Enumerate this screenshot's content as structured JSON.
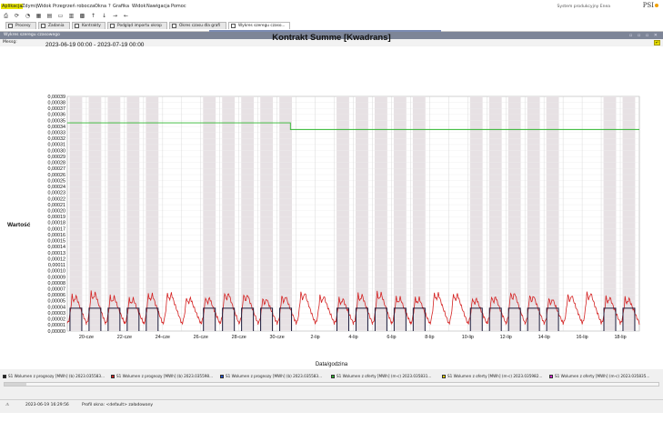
{
  "menu": {
    "items": [
      "Aplikacja",
      "Zdymij",
      "Widok",
      "Przegrzeń robocza",
      "Okna",
      "?",
      "Grafika",
      "Widok",
      "Nawigacja",
      "Pomoc"
    ],
    "highlight_color": "#e8e600"
  },
  "header": {
    "system_name": "System produkcyjny Enea",
    "logo_text": "PSI"
  },
  "toolbar": {
    "icons": [
      "print-icon",
      "refresh-icon",
      "chart-icon",
      "grid-icon",
      "table-icon",
      "window-icon",
      "layout-icon",
      "tile-icon",
      "arrow-up-icon",
      "arrow-down-icon",
      "arrow-right-icon",
      "arrow-left-icon"
    ]
  },
  "tabs": [
    {
      "label": "Procesy",
      "active": false
    },
    {
      "label": "Zadania",
      "active": false
    },
    {
      "label": "Kontrakty",
      "active": false
    },
    {
      "label": "Podgląd importu okrop",
      "active": false
    },
    {
      "label": "Okres czasu dla grafi",
      "active": false
    },
    {
      "label": "Wykres szeregu czaso...",
      "active": true
    }
  ],
  "panel": {
    "title": "Wykres szeregu czasowego",
    "controls": "▫ ▫ ▫ ✕"
  },
  "message_bar": {
    "label": "Messg:"
  },
  "chart_data": {
    "type": "line",
    "title": "Kontrakt Summe [Kwadrans]",
    "date_range": "2023-06-19 00:00 - 2023-07-19 00:00",
    "ylabel": "Wartość",
    "xlabel": "Data/godzina",
    "ylim": [
      0.0,
      0.00039
    ],
    "y_tick_step": 1e-05,
    "x_range_days": [
      0,
      30
    ],
    "x_ticks": [
      {
        "day": 1,
        "label": "20-cze"
      },
      {
        "day": 3,
        "label": "22-cze"
      },
      {
        "day": 5,
        "label": "24-cze"
      },
      {
        "day": 7,
        "label": "26-cze"
      },
      {
        "day": 9,
        "label": "28-cze"
      },
      {
        "day": 11,
        "label": "30-cze"
      },
      {
        "day": 13,
        "label": "2-lip"
      },
      {
        "day": 15,
        "label": "4-lip"
      },
      {
        "day": 17,
        "label": "6-lip"
      },
      {
        "day": 19,
        "label": "8-lip"
      },
      {
        "day": 21,
        "label": "10-lip"
      },
      {
        "day": 23,
        "label": "12-lip"
      },
      {
        "day": 25,
        "label": "14-lip"
      },
      {
        "day": 27,
        "label": "16-lip"
      },
      {
        "day": 29,
        "label": "18-lip"
      }
    ],
    "shaded_days": [
      0,
      1,
      2,
      3,
      4,
      7,
      8,
      9,
      10,
      11,
      14,
      15,
      16,
      17,
      18,
      21,
      22,
      23,
      24,
      25,
      28,
      29
    ],
    "grid": true,
    "series": [
      {
        "name": "S1 Wolumen z oferty [MWh] (m-c) 2023.035831...",
        "color": "#2fb62f",
        "x": [
          0,
          11.7,
          11.7,
          30
        ],
        "y": [
          0.000346,
          0.000346,
          0.000335,
          0.000335
        ]
      },
      {
        "name": "S1 Wolumen z prognozy [MWh] (b) 2023.035598...",
        "color": "#d42020",
        "profile": "daily",
        "daily_peak": 6.5e-05,
        "daily_min": 1.3e-05,
        "days": [
          0,
          30
        ]
      },
      {
        "name": "S1 Wolumen z prognozy [MWh] (b) 2023.035583...",
        "color": "#1a1a3a",
        "profile": "block",
        "block_level": 3.8e-05,
        "days": [
          0,
          1,
          2,
          3,
          4,
          7,
          8,
          9,
          10,
          11,
          14,
          15,
          16,
          17,
          18,
          21,
          22,
          23,
          24,
          25,
          28,
          29
        ]
      }
    ]
  },
  "legend": [
    {
      "label": "S1 Wolumen z prognozy [MWh] (b) 2023.035583...",
      "color": "#222222"
    },
    {
      "label": "S1 Wolumen z prognozy [MWh] (b) 2023.035598...",
      "color": "#d42020"
    },
    {
      "label": "S1 Wolumen z prognozy [MWh] (b) 2023.035583...",
      "color": "#2050d0"
    },
    {
      "label": "S1 Wolumen z oferty [MWh] (m-c) 2023.035831...",
      "color": "#2fb62f"
    },
    {
      "label": "S1 Wolumen z oferty [MWh] (m-c) 2023.035982...",
      "color": "#e8d000"
    },
    {
      "label": "S1 Wolumen z oferty [MWh] (m-c) 2023.035835...",
      "color": "#d020d0"
    }
  ],
  "status": {
    "timestamp": "2023-06-19 16:29:56",
    "message": "Profil okna: <default> załadowany"
  }
}
